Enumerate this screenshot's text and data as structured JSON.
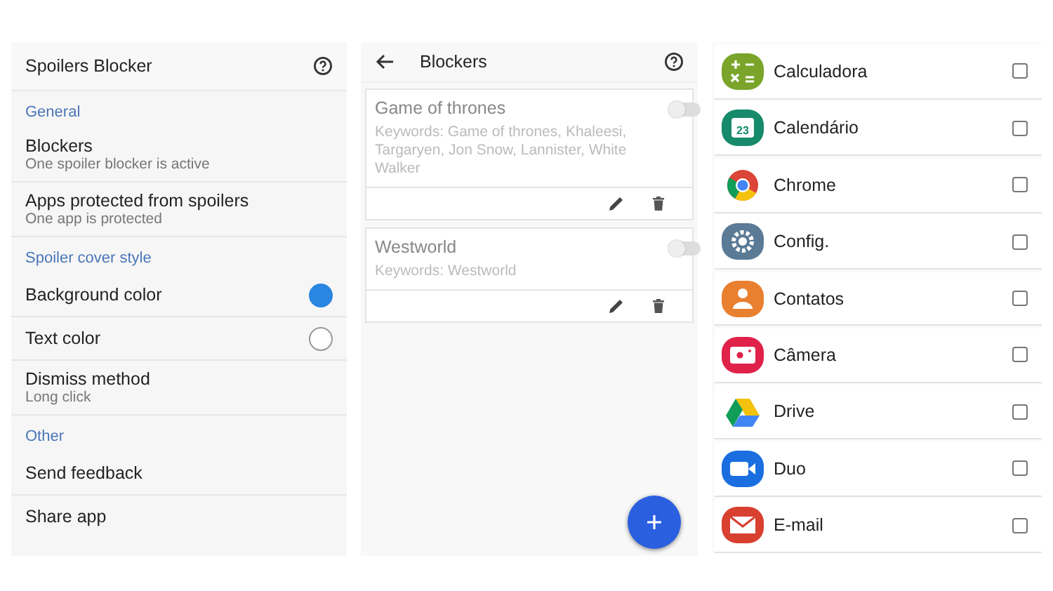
{
  "settings": {
    "title": "Spoilers Blocker",
    "items": [
      {
        "kind": "section",
        "label": "General"
      },
      {
        "kind": "item",
        "label": "Blockers",
        "subtitle": "One spoiler blocker is active"
      },
      {
        "kind": "item",
        "label": "Apps protected from spoilers",
        "subtitle": "One app is protected"
      },
      {
        "kind": "section",
        "label": "Spoiler cover style"
      },
      {
        "kind": "radio",
        "label": "Background color",
        "selected": true
      },
      {
        "kind": "radio",
        "label": "Text color",
        "selected": false
      },
      {
        "kind": "item",
        "label": "Dismiss method",
        "subtitle": "Long click"
      },
      {
        "kind": "section",
        "label": "Other"
      },
      {
        "kind": "item",
        "label": "Send feedback"
      },
      {
        "kind": "item",
        "label": "Share app"
      }
    ]
  },
  "blockers": {
    "title": "Blockers",
    "cards": [
      {
        "name": "Game of thrones",
        "keywords": "Keywords: Game of thrones, Khaleesi, Targaryen, Jon Snow, Lannister, White Walker",
        "on": false
      },
      {
        "name": "Westworld",
        "keywords": "Keywords: Westworld",
        "on": false
      }
    ]
  },
  "apps": [
    {
      "name": "Calculadora",
      "kind": "calculator",
      "checked": false
    },
    {
      "name": "Calendário",
      "kind": "calendar",
      "icon_text": "23",
      "checked": false
    },
    {
      "name": "Chrome",
      "kind": "browser",
      "checked": false
    },
    {
      "name": "Config.",
      "kind": "gear",
      "checked": false
    },
    {
      "name": "Contatos",
      "kind": "contact",
      "checked": false
    },
    {
      "name": "Câmera",
      "kind": "camera",
      "checked": false
    },
    {
      "name": "Drive",
      "kind": "drive",
      "checked": false
    },
    {
      "name": "Duo",
      "kind": "video",
      "checked": false
    },
    {
      "name": "E-mail",
      "kind": "mail",
      "checked": false
    }
  ]
}
